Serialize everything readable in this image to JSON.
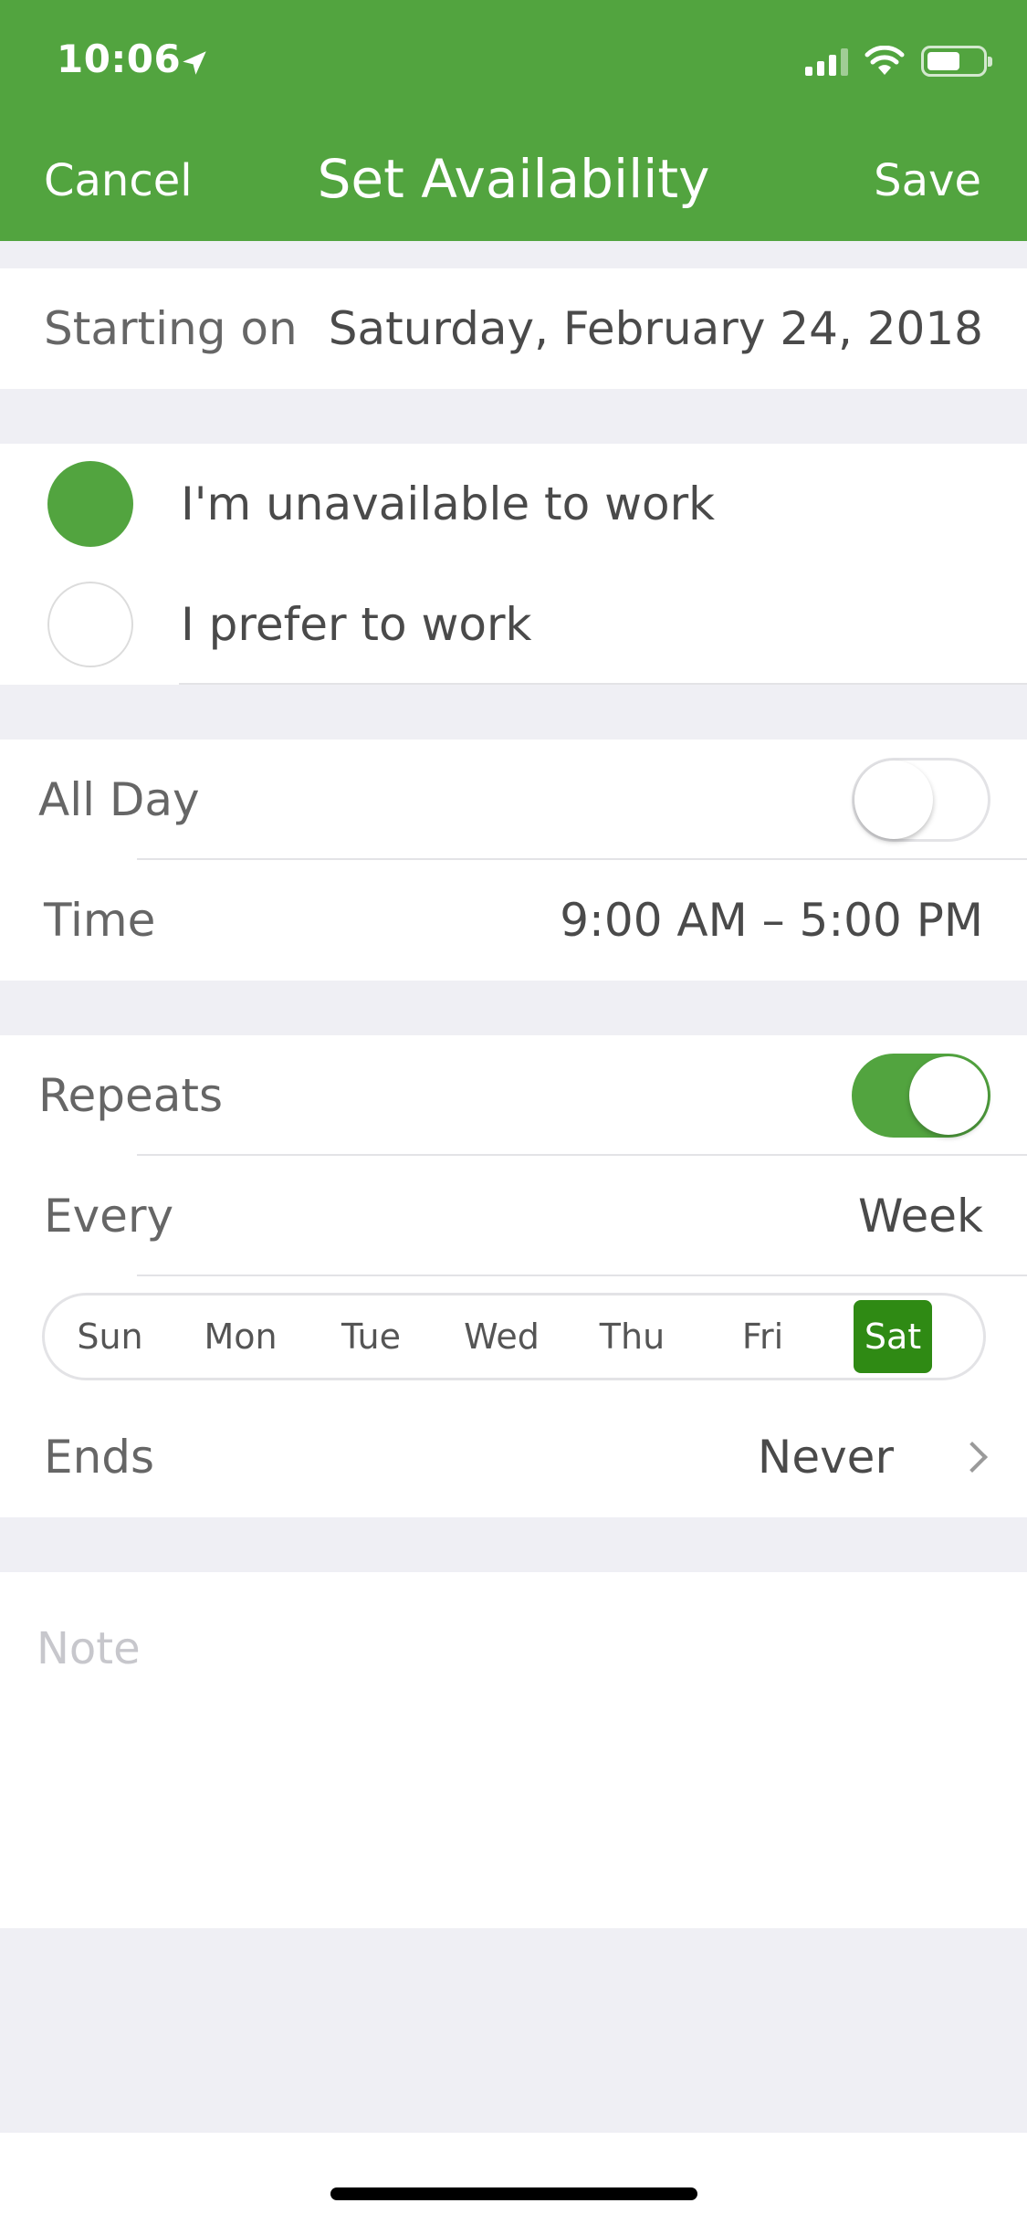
{
  "status_bar": {
    "time": "10:06"
  },
  "nav": {
    "cancel": "Cancel",
    "title": "Set Availability",
    "save": "Save"
  },
  "start": {
    "label": "Starting on",
    "value": "Saturday, February 24, 2018"
  },
  "availability": {
    "options": [
      "I'm unavailable to work",
      "I prefer to work"
    ],
    "selected": "I'm unavailable to work"
  },
  "all_day": {
    "label": "All Day",
    "enabled": false
  },
  "time": {
    "label": "Time",
    "value": "9:00 AM – 5:00 PM"
  },
  "repeats": {
    "label": "Repeats",
    "enabled": true
  },
  "every": {
    "label": "Every",
    "value": "Week"
  },
  "days": {
    "items": [
      "Sun",
      "Mon",
      "Tue",
      "Wed",
      "Thu",
      "Fri",
      "Sat"
    ],
    "selected": "Sat"
  },
  "ends": {
    "label": "Ends",
    "value": "Never"
  },
  "note": {
    "placeholder": "Note"
  },
  "colors": {
    "brand": "#52a43f",
    "selected_day": "#2f8a14"
  }
}
